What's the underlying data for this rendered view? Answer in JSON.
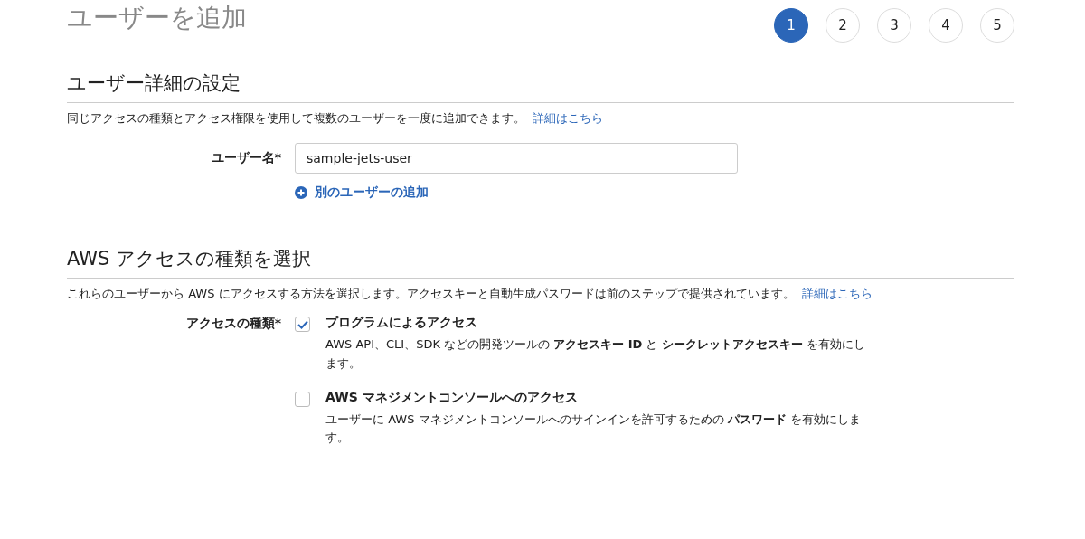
{
  "page_title": "ユーザーを追加",
  "steps": [
    {
      "label": "1",
      "selected": true
    },
    {
      "label": "2",
      "selected": false
    },
    {
      "label": "3",
      "selected": false
    },
    {
      "label": "4",
      "selected": false
    },
    {
      "label": "5",
      "selected": false
    }
  ],
  "user_details": {
    "heading": "ユーザー詳細の設定",
    "description": "同じアクセスの種類とアクセス権限を使用して複数のユーザーを一度に追加できます。",
    "link": "詳細はこちら",
    "username_label": "ユーザー名*",
    "username_value": "sample-jets-user",
    "add_user_link": "別のユーザーの追加"
  },
  "access_type": {
    "heading": "AWS アクセスの種類を選択",
    "description": "これらのユーザーから AWS にアクセスする方法を選択します。アクセスキーと自動生成パスワードは前のステップで提供されています。",
    "link": "詳細はこちら",
    "label": "アクセスの種類*",
    "options": [
      {
        "title": "プログラムによるアクセス",
        "description": "AWS API、CLI、SDK などの開発ツールの **アクセスキー ID** と **シークレットアクセスキー** を有効にします。",
        "checked": true
      },
      {
        "title": "AWS マネジメントコンソールへのアクセス",
        "description": "ユーザーに AWS マネジメントコンソールへのサインインを許可するための **パスワード** を有効にします。",
        "checked": false
      }
    ]
  }
}
